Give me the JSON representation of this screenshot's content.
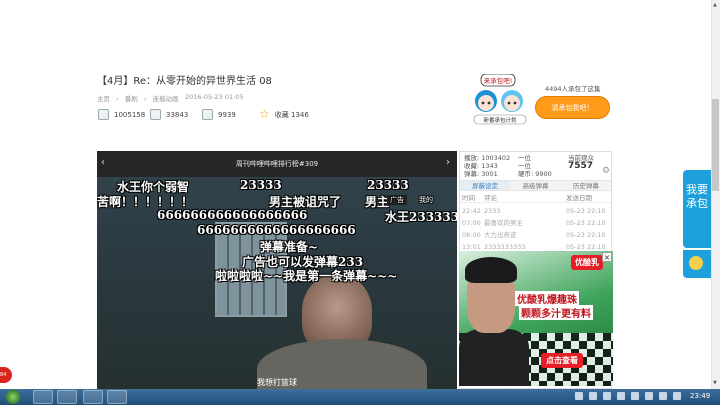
{
  "page": {
    "title": "【4月】Re：从零开始的异世界生活 08",
    "breadcrumb": [
      "主页",
      "番剧",
      "连载动画"
    ],
    "date": "2016-05-23 01:05",
    "stats": {
      "plays": "1005158",
      "danmaku": "33843",
      "coins": "9939",
      "favorite_label": "收藏 1346"
    }
  },
  "promo": {
    "bubble": "来承包吧!",
    "plan_label": "新番承包计划",
    "count_text": "4494人承包了这集",
    "button_label": "请承包我吧！"
  },
  "side_tab": {
    "label": "我要承包"
  },
  "player": {
    "title": "周刊哔哩哔哩排行榜#309",
    "subtitle": "我想打篮球",
    "danmaku": [
      "水王你个弱智",
      "23333",
      "23333",
      "苦啊！！！！！！",
      "男主被诅咒了",
      "男主",
      "666666666666666666",
      "水王233333",
      "6666666666666666666",
      "弹幕准备~",
      "广告也可以发弹幕233",
      "啦啦啦啦~~我是第一条弹幕~~~",
      "广告",
      "我的"
    ]
  },
  "panel": {
    "left_stats": [
      "播放: 1003402",
      "收藏: 1343",
      "弹幕: 3001"
    ],
    "mid_stats": [
      "一位",
      "一位",
      "硬币: 9900"
    ],
    "online_label": "当前观众",
    "online_count": "7557",
    "tabs": [
      "屏蔽设定",
      "高级弹幕",
      "历史弹幕"
    ],
    "headers": [
      "时间",
      "评论",
      "发送日期"
    ],
    "rows": [
      [
        "22:42",
        "2333",
        "05-23 22:10"
      ],
      [
        "07:00",
        "最喜欢的男主",
        "05-23 22:10"
      ],
      [
        "08:00",
        "大力出奇迹",
        "05-23 22:10"
      ],
      [
        "13:01",
        "2333333333",
        "05-23 22:10"
      ]
    ]
  },
  "ad": {
    "brand": "优酸乳",
    "line1": "优酸乳爆趣珠",
    "line2": "颗颗多汁更有料",
    "cta": "点击查看"
  },
  "taskbar": {
    "clock": "23:49"
  },
  "badge": {
    "text": "84"
  }
}
